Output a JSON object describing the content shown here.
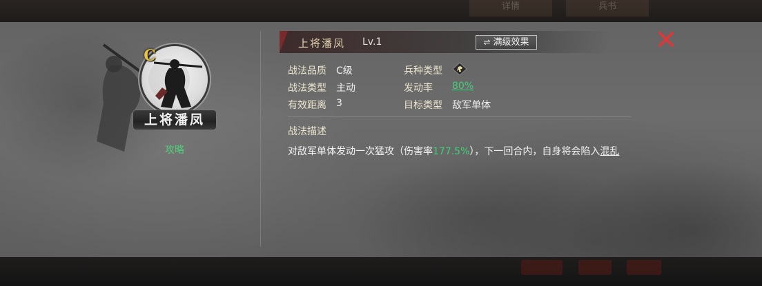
{
  "skill": {
    "name": "上将潘凤",
    "level": "Lv.1",
    "quality_badge": "C",
    "portrait_name": "上将潘凤",
    "guide_link": "攻略"
  },
  "toolbar": {
    "max_effect_label": "满级效果",
    "max_effect_icon": "swap-arrows-icon",
    "close_icon": "close-x-icon"
  },
  "attributes": [
    {
      "label": "战法品质",
      "value": "C级"
    },
    {
      "label": "兵种类型",
      "value": "",
      "icon": "cavalry-icon"
    },
    {
      "label": "战法类型",
      "value": "主动"
    },
    {
      "label": "发动率",
      "value": "80%"
    },
    {
      "label": "有效距离",
      "value": "3"
    },
    {
      "label": "目标类型",
      "value": "敌军单体"
    }
  ],
  "description": {
    "title": "战法描述",
    "text_before": "对敌军单体发动一次猛攻（伤害率",
    "damage_rate": "177.5%",
    "text_after": "），下一回合内，自身将会陷入",
    "keyword": "混乱"
  },
  "background": {
    "top_tabs": [
      "详情",
      "兵书"
    ]
  },
  "colors": {
    "accent_green": "#3fd07a",
    "close_red": "#d63a3a",
    "quality_gold": "#e8c53c",
    "label_cream": "#ece5cf"
  }
}
